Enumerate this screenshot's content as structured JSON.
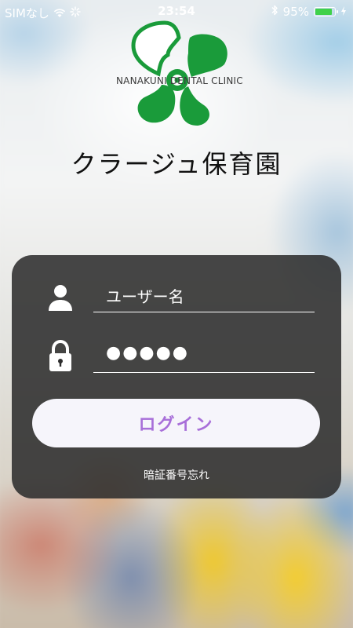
{
  "status_bar": {
    "carrier": "SIMなし",
    "time": "23:54",
    "battery_percent": "95%",
    "battery_level": 0.95,
    "battery_color": "#3fd14a"
  },
  "logo": {
    "text": "NANAKUNI DENTAL CLINIC",
    "color": "#1a9b3a"
  },
  "app_title": "クラージュ保育園",
  "login_form": {
    "username_placeholder": "ユーザー名",
    "password_value": "●●●●●",
    "login_button": "ログイン",
    "login_button_color": "#a86fd9",
    "forgot_password": "暗証番号忘れ"
  },
  "icons": {
    "user": "user-icon",
    "lock": "lock-icon",
    "wifi": "wifi-icon",
    "bluetooth": "bluetooth-icon",
    "battery": "battery-icon",
    "charging": "charging-bolt-icon",
    "activity": "activity-icon"
  }
}
